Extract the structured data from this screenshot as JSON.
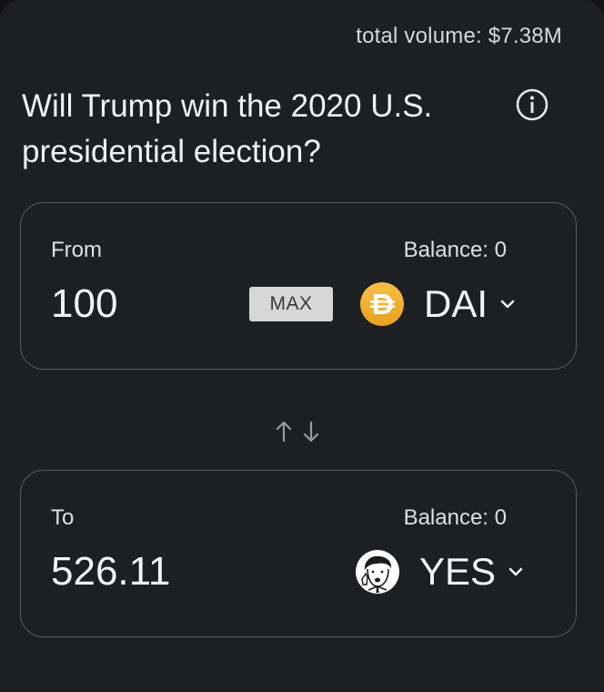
{
  "header": {
    "total_volume": "total volume: $7.38M"
  },
  "market": {
    "question": "Will Trump win the 2020 U.S. presidential election?",
    "info_icon": "info-circle-icon"
  },
  "from_card": {
    "label": "From",
    "balance": "Balance: 0",
    "amount": "100",
    "max_label": "MAX",
    "token": "DAI",
    "token_icon": "dai-coin-icon",
    "token_color": "#f4b731"
  },
  "swap": {
    "icon": "swap-arrows-icon"
  },
  "to_card": {
    "label": "To",
    "balance": "Balance: 0",
    "amount": "526.11",
    "token": "YES",
    "token_icon": "trump-avatar-icon"
  },
  "colors": {
    "background": "#1e1f22",
    "border": "#5a5b5e",
    "text": "#f1f1f1",
    "max_button_bg": "#d7d7d7"
  }
}
